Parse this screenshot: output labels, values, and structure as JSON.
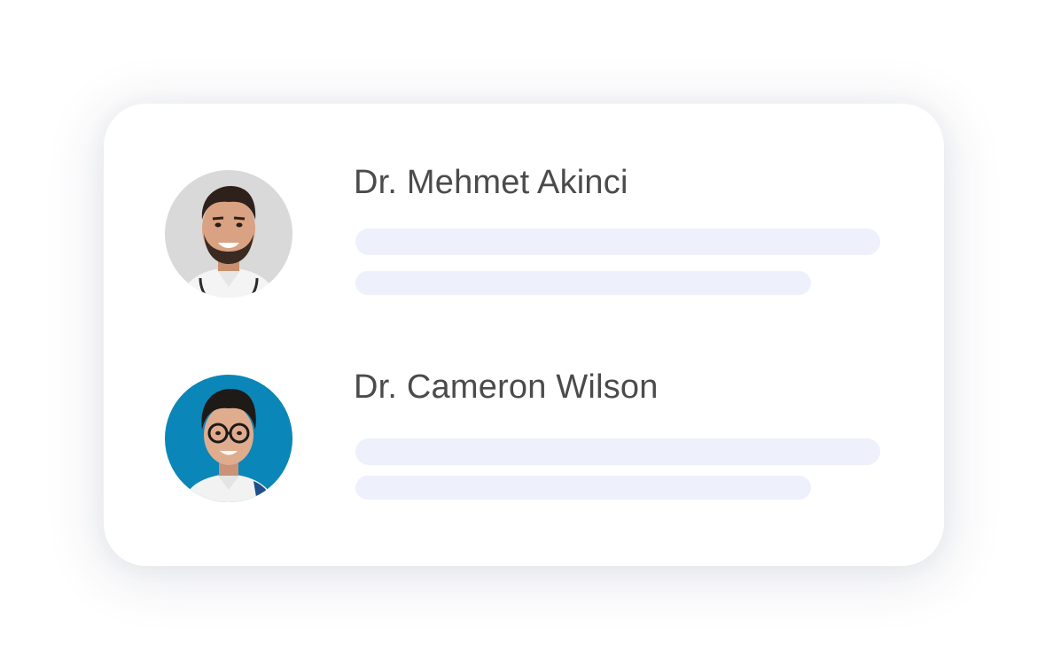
{
  "doctors": [
    {
      "name": "Dr. Mehmet Akinci",
      "avatar_icon": "doctor-portrait",
      "avatar_bg": "#d9d9d9"
    },
    {
      "name": "Dr. Cameron Wilson",
      "avatar_icon": "doctor-portrait-glasses",
      "avatar_bg": "#0b86b8"
    }
  ],
  "colors": {
    "name_text": "#4b4b4b",
    "placeholder_bar": "#eef0fb",
    "card_bg": "#ffffff"
  }
}
